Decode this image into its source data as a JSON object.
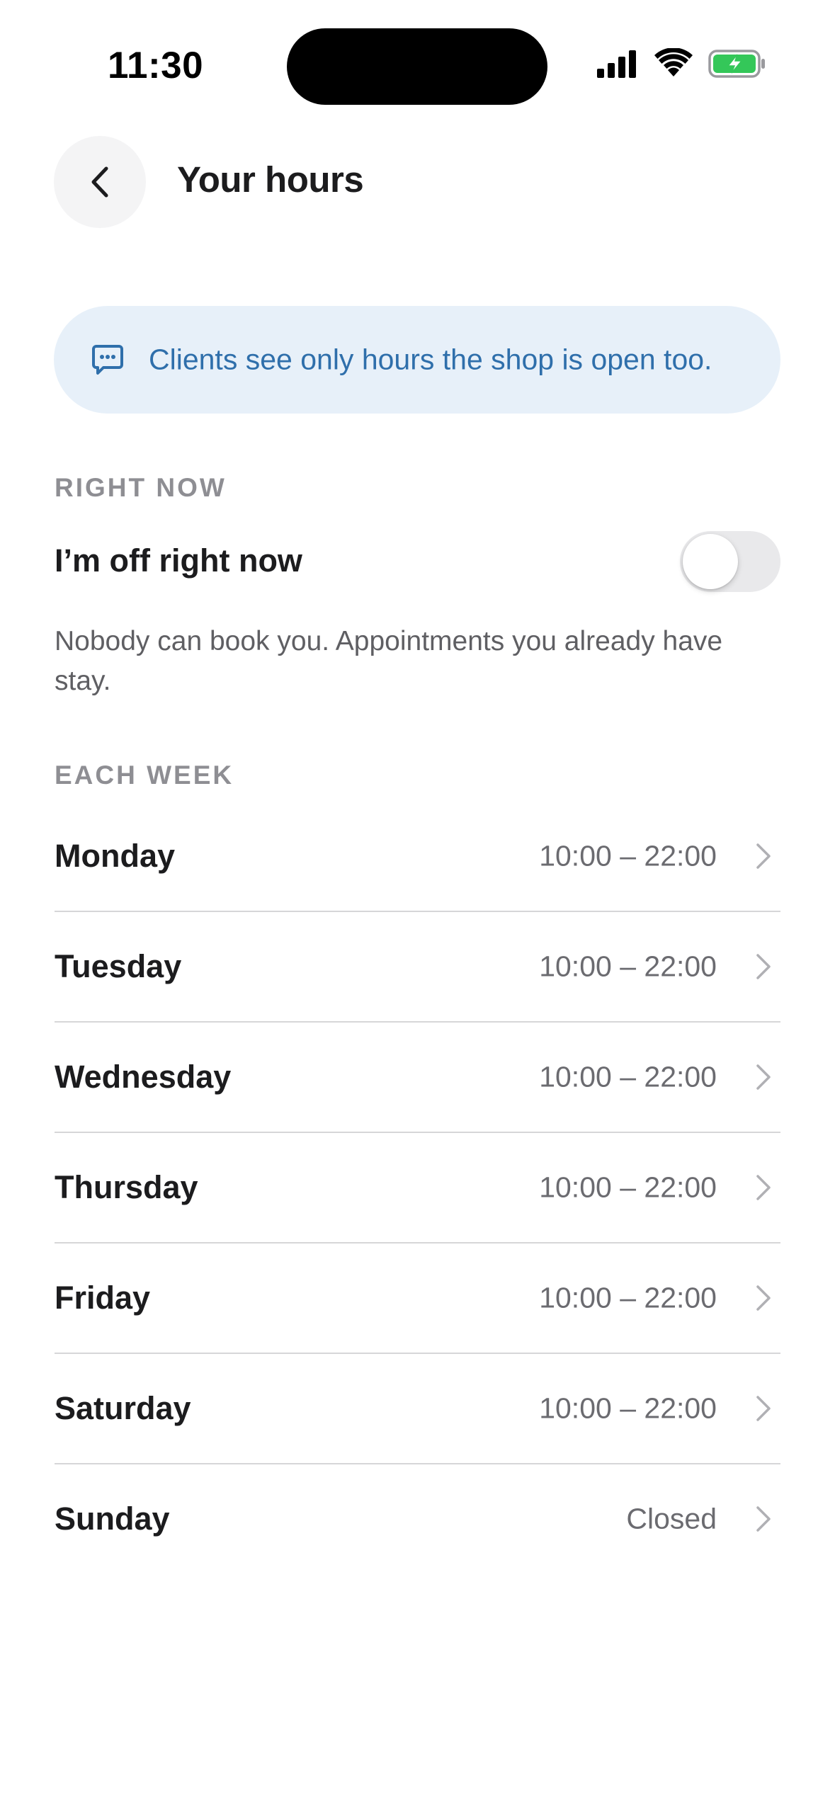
{
  "status_bar": {
    "time": "11:30"
  },
  "header": {
    "title": "Your hours",
    "back_icon": "chevron-left-icon"
  },
  "info_banner": {
    "icon": "chat-bubble-icon",
    "text": "Clients see only hours the shop is open too."
  },
  "right_now": {
    "section_label": "RIGHT NOW",
    "toggle_label": "I’m off right now",
    "toggle_on": false,
    "description": "Nobody can book you. Appointments you already have stay."
  },
  "each_week": {
    "section_label": "EACH WEEK",
    "days": [
      {
        "name": "Monday",
        "hours": "10:00 – 22:00"
      },
      {
        "name": "Tuesday",
        "hours": "10:00 – 22:00"
      },
      {
        "name": "Wednesday",
        "hours": "10:00 – 22:00"
      },
      {
        "name": "Thursday",
        "hours": "10:00 – 22:00"
      },
      {
        "name": "Friday",
        "hours": "10:00 – 22:00"
      },
      {
        "name": "Saturday",
        "hours": "10:00 – 22:00"
      },
      {
        "name": "Sunday",
        "hours": "Closed"
      }
    ]
  },
  "colors": {
    "banner_bg": "#e7f0f9",
    "banner_text": "#2f6fab",
    "battery_green": "#34c759",
    "toggle_off": "#e9e9eb"
  }
}
